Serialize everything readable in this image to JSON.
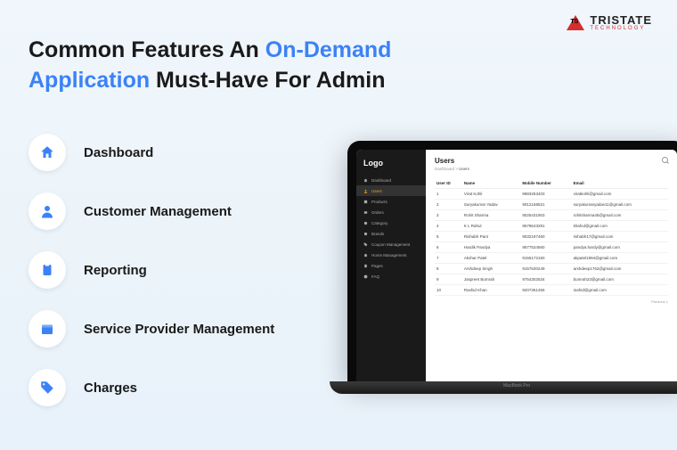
{
  "brand": {
    "top": "TRISTATE",
    "bottom": "TECHNOLOGY"
  },
  "heading": {
    "p1": "Common Features An ",
    "hl": "On-Demand Application",
    "p2": " Must-Have For Admin"
  },
  "features": [
    {
      "label": "Dashboard"
    },
    {
      "label": "Customer Management"
    },
    {
      "label": "Reporting"
    },
    {
      "label": "Service Provider Management"
    },
    {
      "label": "Charges"
    }
  ],
  "sidebar": {
    "logo": "Logo",
    "items": [
      {
        "label": "Dashboard"
      },
      {
        "label": "Users"
      },
      {
        "label": "Products"
      },
      {
        "label": "Orders"
      },
      {
        "label": "Category"
      },
      {
        "label": "Brands"
      },
      {
        "label": "Coupon Management"
      },
      {
        "label": "Home Management"
      },
      {
        "label": "Pages"
      },
      {
        "label": "FAQ"
      }
    ],
    "active_index": 1
  },
  "page": {
    "title": "Users",
    "crumb1": "Dashboard",
    "crumb_sep": " > ",
    "crumb2": "Users",
    "cols": [
      "User ID",
      "Name",
      "Mobile Number",
      "Email"
    ],
    "rows": [
      {
        "id": "1",
        "name": "Virat Kohli",
        "mobile": "9983263403",
        "email": "viratkohli@gmail.com"
      },
      {
        "id": "2",
        "name": "Suryakumar Yadav",
        "mobile": "9012168521",
        "email": "suryakumaryadav11@gmail.com"
      },
      {
        "id": "3",
        "name": "Rohit Sharma",
        "mobile": "8026431903",
        "email": "rohitsharma45@gmail.com"
      },
      {
        "id": "4",
        "name": "K L Rahul",
        "mobile": "8679643291",
        "email": "klrahul@gmail.com"
      },
      {
        "id": "5",
        "name": "Rishabh Pant",
        "mobile": "9032197460",
        "email": "rishabh17@gmail.com"
      },
      {
        "id": "6",
        "name": "Hardik Pandya",
        "mobile": "9577534560",
        "email": "pandya.hardy@gmail.com"
      },
      {
        "id": "7",
        "name": "Akshar Patel",
        "mobile": "9155172160",
        "email": "akpatel1994@gmail.com"
      },
      {
        "id": "8",
        "name": "Arshdeep Singh",
        "mobile": "9157530249",
        "email": "arshdeep1762@gmail.com"
      },
      {
        "id": "9",
        "name": "Jaspreet Bumrah",
        "mobile": "9754302534",
        "email": "bumrah23@gmail.com"
      },
      {
        "id": "10",
        "name": "Rashid Khan",
        "mobile": "9207361455",
        "email": "rashid@gmail.com"
      }
    ],
    "pagination": "Previous  1"
  }
}
